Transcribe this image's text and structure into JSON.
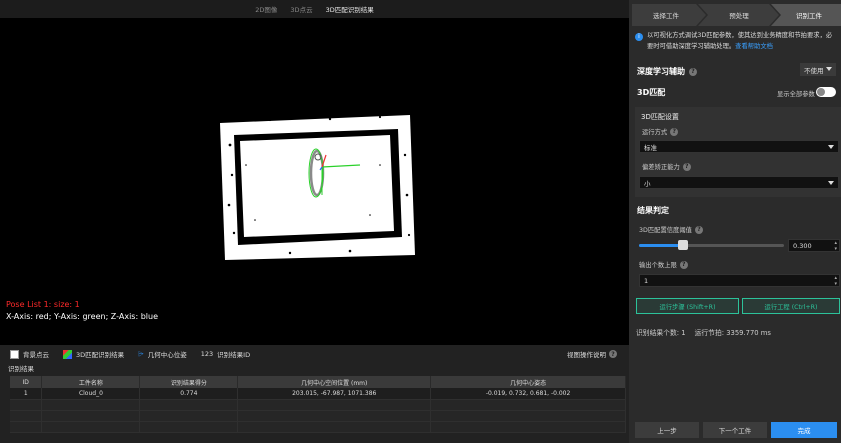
{
  "viewer": {
    "tabs": [
      "2D图像",
      "3D点云",
      "3D匹配识别结果"
    ],
    "active_tab": 2,
    "pose_line1": "Pose List 1: size: 1",
    "pose_line2": "X-Axis: red; Y-Axis: green; Z-Axis: blue"
  },
  "options": {
    "background_cloud": "背景点云",
    "match_result": "3D匹配识别结果",
    "center_pose": "几何中心位姿",
    "result_id_prefix": "123",
    "result_id": "识别结果ID",
    "manual": "视图操作说明"
  },
  "results": {
    "title": "识别结果",
    "columns": [
      "ID",
      "工件名称",
      "识别结果得分",
      "几何中心空间位置 (mm)",
      "几何中心姿态"
    ],
    "rows": [
      [
        "1",
        "Cloud_0",
        "0.774",
        "203.015, -67.987, 1071.386",
        "-0.019, 0.732, 0.681, -0.002"
      ]
    ]
  },
  "panel": {
    "steps": [
      "选择工件",
      "预处理",
      "识别工件"
    ],
    "info_text": "以可视化方式调试3D匹配参数，使其达到业务精度和节拍要求，必要时可借助深度学习辅助处理。",
    "info_link": "查看帮助文档",
    "dl_title": "深度学习辅助",
    "dl_value": "不使用",
    "match_title": "3D匹配",
    "show_all": "显示全部参数",
    "match_settings": "3D匹配设置",
    "run_mode_label": "运行方式",
    "run_mode_value": "标准",
    "bias_label": "偏差矫正能力",
    "bias_value": "小",
    "judge_title": "结果判定",
    "threshold_label": "3D匹配置信度阈值",
    "threshold_value": "0.300",
    "threshold_fraction": 0.3,
    "max_label": "输出个数上限",
    "max_value": "1",
    "run_step": "运行步骤 (Shift+R)",
    "run_project": "运行工程 (Ctrl+R)",
    "result_count": "识别结果个数: 1",
    "cycle_time": "运行节拍: 3359.770 ms",
    "prev": "上一步",
    "next_part": "下一个工件",
    "finish": "完成"
  },
  "colors": {
    "accent": "#2b8ef0",
    "run_green": "#2cc29a",
    "pose_red": "#ff2a2a"
  }
}
